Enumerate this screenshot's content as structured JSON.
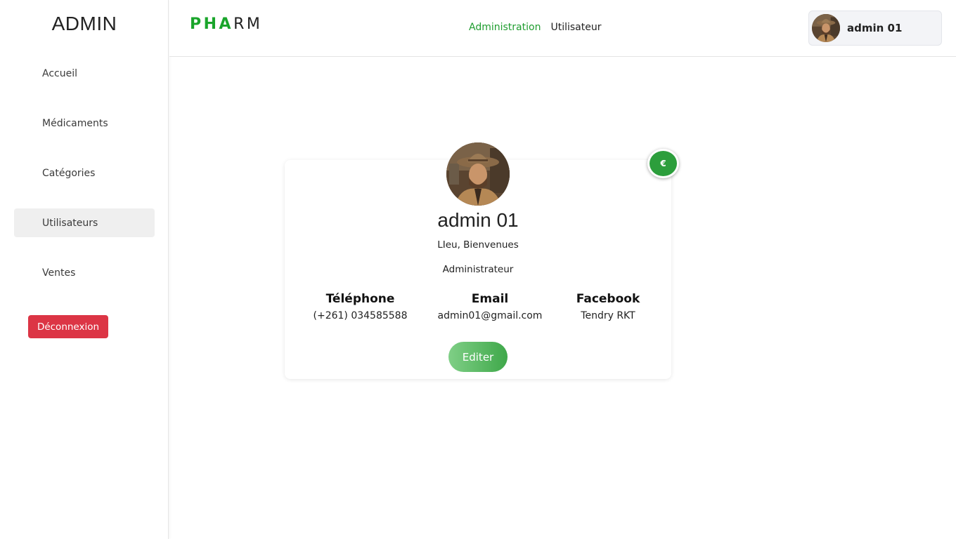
{
  "sidebar": {
    "brand": "ADMIN",
    "items": [
      {
        "label": "Accueil"
      },
      {
        "label": "Médicaments"
      },
      {
        "label": "Catégories"
      },
      {
        "label": "Utilisateurs",
        "active": true
      },
      {
        "label": "Ventes"
      }
    ],
    "logout_label": "Déconnexion"
  },
  "header": {
    "logo_green": "PHA",
    "logo_dark": "RM",
    "nav": [
      {
        "label": "Administration",
        "active": true
      },
      {
        "label": "Utilisateur"
      }
    ],
    "user_name": "admin 01"
  },
  "profile": {
    "name": "admin 01",
    "greeting": "LIeu, Bienvenues",
    "role": "Administrateur",
    "phone_label": "Téléphone",
    "phone_value": "(+261) 034585588",
    "email_label": "Email",
    "email_value": "admin01@gmail.com",
    "facebook_label": "Facebook",
    "facebook_value": "Tendry RKT",
    "edit_label": "Editer"
  },
  "fab": {
    "symbol": "€",
    "icon": "euro-icon"
  },
  "colors": {
    "accent": "#1f9d2f",
    "danger": "#dc3545",
    "active_bg": "#efefef"
  }
}
